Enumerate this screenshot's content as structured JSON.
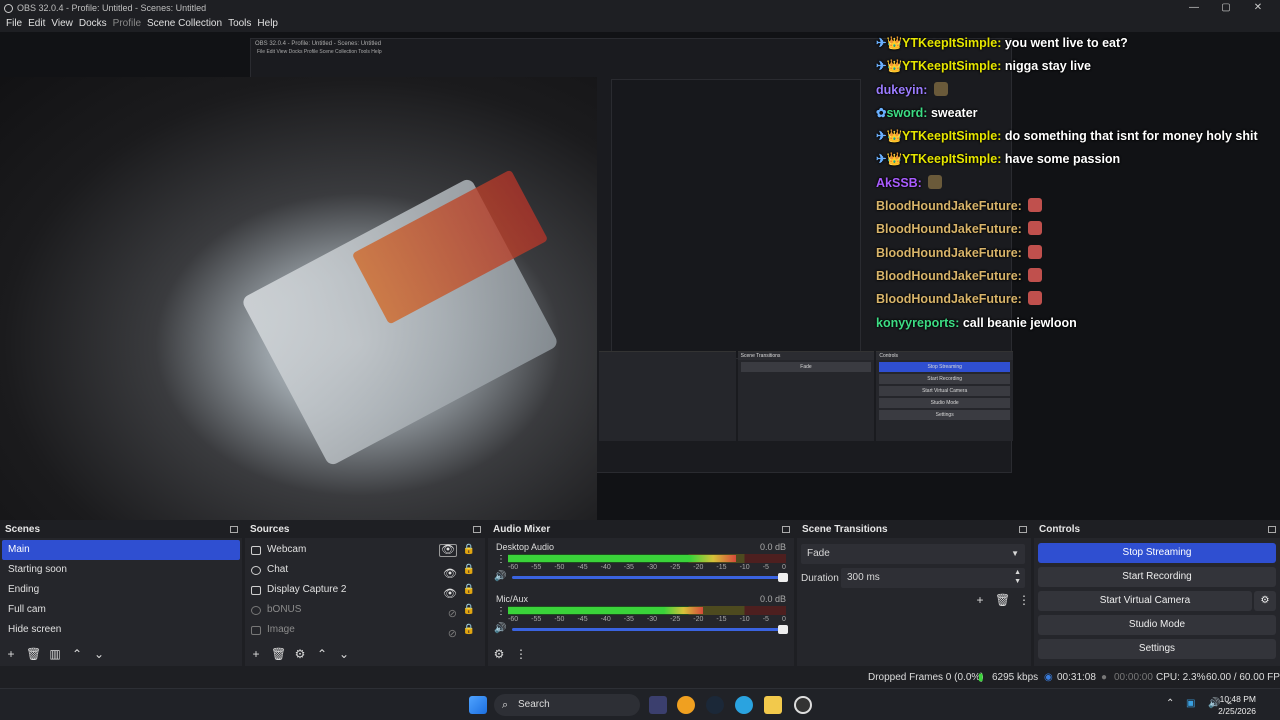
{
  "window": {
    "title": "OBS 32.0.4 - Profile: Untitled - Scenes: Untitled",
    "controls": [
      "—",
      "▢",
      "✕"
    ]
  },
  "menu": {
    "file": "File",
    "edit": "Edit",
    "view": "View",
    "docks": "Docks",
    "profile": "Profile",
    "scene_collection": "Scene Collection",
    "tools": "Tools",
    "help": "Help"
  },
  "chat": [
    {
      "name": "YTKeepItSimple:",
      "name_color": "#e6e600",
      "badges": "✈👑",
      "msg": "you went live to eat?"
    },
    {
      "name": "YTKeepItSimple:",
      "name_color": "#e6e600",
      "badges": "✈👑",
      "msg": "nigga stay live"
    },
    {
      "name": "dukeyin:",
      "name_color": "#9b7cff",
      "badges": "",
      "msg": ""
    },
    {
      "name": "sword:",
      "name_color": "#3ddc84",
      "badges": "✿",
      "msg": "sweater"
    },
    {
      "name": "YTKeepItSimple:",
      "name_color": "#e6e600",
      "badges": "✈👑",
      "msg": "do something that isnt for money holy shit"
    },
    {
      "name": "YTKeepItSimple:",
      "name_color": "#e6e600",
      "badges": "✈👑",
      "msg": "have some passion"
    },
    {
      "name": "AkSSB:",
      "name_color": "#a95cff",
      "badges": "",
      "msg": ""
    },
    {
      "name": "BloodHoundJakeFuture:",
      "name_color": "#d8b46a",
      "badges": "",
      "msg": ""
    },
    {
      "name": "BloodHoundJakeFuture:",
      "name_color": "#d8b46a",
      "badges": "",
      "msg": ""
    },
    {
      "name": "BloodHoundJakeFuture:",
      "name_color": "#d8b46a",
      "badges": "",
      "msg": ""
    },
    {
      "name": "BloodHoundJakeFuture:",
      "name_color": "#d8b46a",
      "badges": "",
      "msg": ""
    },
    {
      "name": "BloodHoundJakeFuture:",
      "name_color": "#d8b46a",
      "badges": "",
      "msg": ""
    },
    {
      "name": "konyyreports:",
      "name_color": "#3ddc84",
      "badges": "",
      "msg": "call beanie jewloon"
    }
  ],
  "scenes": {
    "title": "Scenes",
    "items": [
      "Main",
      "Starting soon",
      "Ending",
      "Full cam",
      "Hide screen"
    ]
  },
  "sources": {
    "title": "Sources",
    "items": [
      "Webcam",
      "Chat",
      "Display Capture 2",
      "bONUS",
      "Image"
    ]
  },
  "audio_mixer": {
    "title": "Audio Mixer",
    "tracks": [
      {
        "name": "Desktop Audio",
        "db": "0.0 dB",
        "level": 0.82
      },
      {
        "name": "Mic/Aux",
        "db": "0.0 dB",
        "level": 0.7
      }
    ],
    "ticks": [
      "-60",
      "-55",
      "-50",
      "-45",
      "-40",
      "-35",
      "-30",
      "-25",
      "-20",
      "-15",
      "-10",
      "-5",
      "0"
    ]
  },
  "transitions": {
    "title": "Scene Transitions",
    "selected": "Fade",
    "duration_label": "Duration",
    "duration_value": "300 ms"
  },
  "controls": {
    "title": "Controls",
    "stop_streaming": "Stop Streaming",
    "start_recording": "Start Recording",
    "start_virtual_camera": "Start Virtual Camera",
    "studio_mode": "Studio Mode",
    "settings": "Settings"
  },
  "status": {
    "dropped_frames": "Dropped Frames 0 (0.0%)",
    "bitrate": "6295 kbps",
    "stream_time": "00:31:08",
    "record_time": "00:00:00",
    "cpu": "CPU: 2.3%",
    "fps": "60.00 / 60.00 FPS"
  },
  "taskbar": {
    "search_placeholder": "Search",
    "time": "10:48 PM",
    "date": "2/25/2026"
  }
}
